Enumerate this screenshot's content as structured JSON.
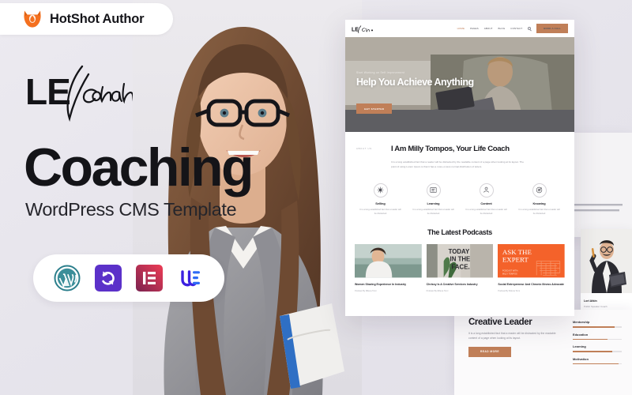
{
  "badge": {
    "label": "HotShot Author",
    "icon": "fox-flame-icon"
  },
  "promo": {
    "logo_primary": "LE",
    "logo_script": "Coach",
    "headline": "Coaching",
    "subheadline": "WordPress CMS Template",
    "tech_badges": [
      {
        "name": "wordpress-icon",
        "label": "WordPress",
        "color": "#21759b"
      },
      {
        "name": "revolution-slider-icon",
        "label": "Revolution Slider",
        "color": "#5b31c9"
      },
      {
        "name": "elementor-icon",
        "label": "Elementor",
        "color": "#e23a5e"
      },
      {
        "name": "unlimited-elements-icon",
        "label": "Unlimited Elements",
        "color": "#3c21e0"
      }
    ]
  },
  "colors": {
    "accent": "#c07f58",
    "background": "#e8e6ec",
    "text_dark": "#141418",
    "badge_orange": "#f4701f"
  },
  "mockup": {
    "nav": {
      "brand_primary": "LE",
      "brand_script": "Coach",
      "links": [
        {
          "label": "HOME",
          "active": true
        },
        {
          "label": "PAGES"
        },
        {
          "label": "ABOUT"
        },
        {
          "label": "BLOG"
        },
        {
          "label": "CONTACT"
        }
      ],
      "search_icon": "search-icon",
      "cta_label": "BOOK A CALL"
    },
    "hero": {
      "eyebrow": "Start Working on Self Improvement",
      "title": "Help You Achieve Anything",
      "cta_label": "GET STARTED"
    },
    "about": {
      "tag": "ABOUT US",
      "title": "I Am Milly Tompos, Your Life Coach",
      "body": "It is a long established fact that a reader will be distracted by the readable content of a page when looking at its layout. The point of using Lorem Ipsum is that it has a more-or-less normal distribution of letters."
    },
    "features": [
      {
        "icon": "selling-icon",
        "title": "Selling",
        "desc": "It is a long established fact that a reader will be distracted"
      },
      {
        "icon": "learning-icon",
        "title": "Learning",
        "desc": "It is a long established fact that a reader will be distracted"
      },
      {
        "icon": "content-icon",
        "title": "Content",
        "desc": "It is a long established fact that a reader will be distracted"
      },
      {
        "icon": "knowing-icon",
        "title": "Knowing",
        "desc": "It is a long established fact that a reader will be distracted"
      }
    ],
    "podcasts": {
      "title": "The Latest Podcasts",
      "items": [
        {
          "title": "Women Sharing Experience In Industry",
          "meta": "Podcast By Milena Tomi"
        },
        {
          "title": "Chrissy Is A Creative Services Industry",
          "meta": "Podcast By Milena Tomi",
          "overlay": "TODAY IN THE FACE."
        },
        {
          "title": "Social Entrepreneur And Chronic Illness Advocate",
          "meta": "Podcast By Milena Tomi",
          "overlay": "ASK THE EXPERT",
          "overlay_sub": "PODCAST WITH: MILLY TOMPOS"
        }
      ]
    },
    "leader": {
      "title": "Creative Leader",
      "body": "It is a long established fact that a reader will be distracted by the readable content of a page when looking at its layout.",
      "cta_label": "READ MORE",
      "skills": [
        {
          "label": "Mentorship",
          "value": 86
        },
        {
          "label": "Education",
          "value": 71
        },
        {
          "label": "Learning",
          "value": 80
        },
        {
          "label": "Motivation",
          "value": 93
        }
      ]
    },
    "person_card": {
      "name": "Lori Atkin",
      "role": "Public Speaker Coach"
    },
    "back_card": {
      "body": "It is a long established fact that a reader will be distracted by the readable content of a page when looking at its layout."
    }
  }
}
